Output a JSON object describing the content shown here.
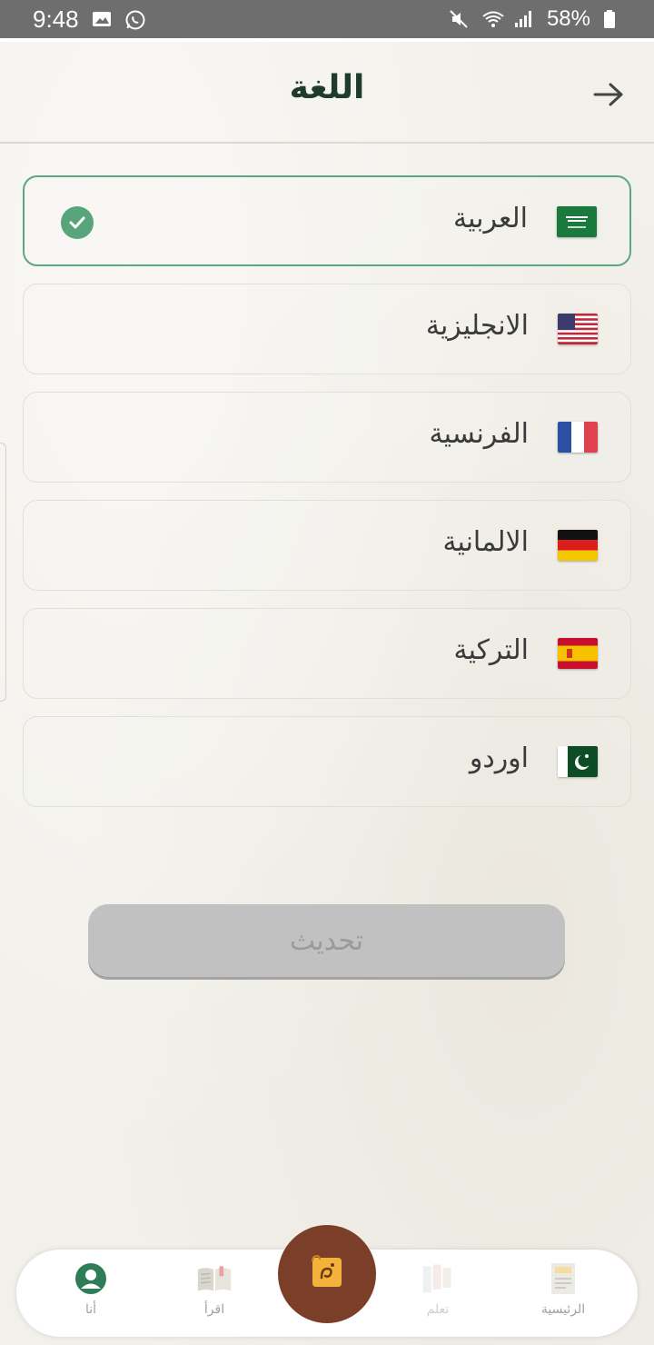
{
  "status_bar": {
    "time": "9:48",
    "battery": "58%"
  },
  "header": {
    "title": "اللغة",
    "back_icon": "arrow-right-icon"
  },
  "languages": [
    {
      "label": "العربية",
      "flag": "saudi-arabia-flag",
      "selected": true
    },
    {
      "label": "الانجليزية",
      "flag": "usa-flag",
      "selected": false
    },
    {
      "label": "الفرنسية",
      "flag": "france-flag",
      "selected": false
    },
    {
      "label": "الالمانية",
      "flag": "germany-flag",
      "selected": false
    },
    {
      "label": "التركية",
      "flag": "spain-flag",
      "selected": false
    },
    {
      "label": "اوردو",
      "flag": "pakistan-flag",
      "selected": false
    }
  ],
  "update_button": {
    "label": "تحديث",
    "enabled": false
  },
  "bottom_nav": {
    "items": [
      {
        "label": "أنا",
        "icon": "profile-icon"
      },
      {
        "label": "اقرأ",
        "icon": "book-icon"
      },
      {
        "label": "تعلم",
        "icon": "learn-icon"
      },
      {
        "label": "الرئيسية",
        "icon": "home-icon"
      }
    ],
    "center_icon": "scroll-icon"
  },
  "colors": {
    "accent_green": "#58a57c",
    "title_green": "#1f3b2a",
    "fab_brown": "#7b3e28",
    "button_disabled": "#c1c1c1"
  }
}
